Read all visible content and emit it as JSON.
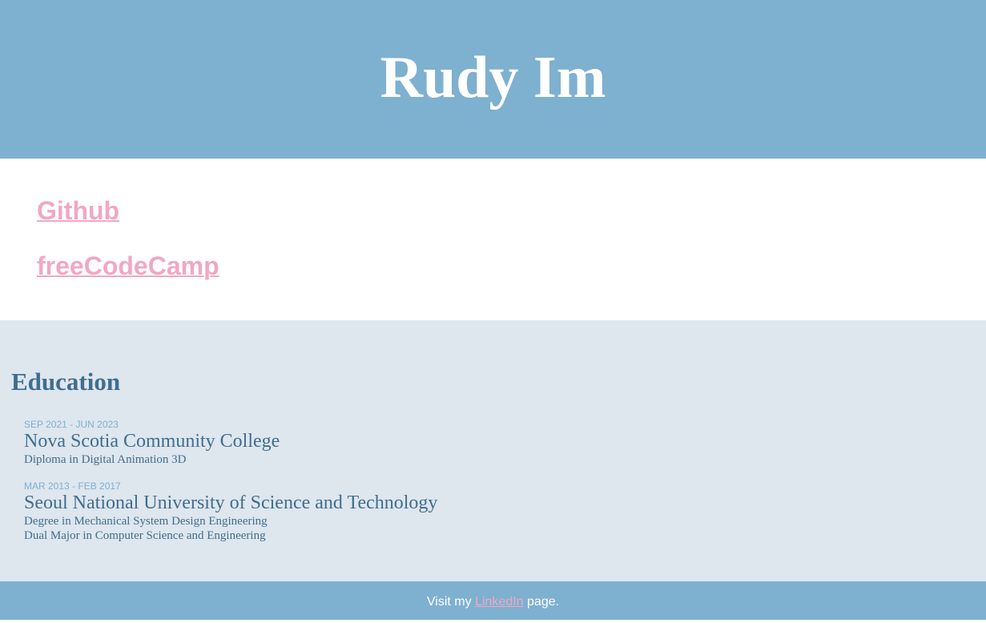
{
  "header": {
    "name": "Rudy Im"
  },
  "links": [
    {
      "label": "Github"
    },
    {
      "label": "freeCodeCamp"
    }
  ],
  "education": {
    "heading": "Education",
    "entries": [
      {
        "dates": "SEP 2021 - JUN 2023",
        "school": "Nova Scotia Community College",
        "details": [
          "Diploma in Digital Animation 3D"
        ]
      },
      {
        "dates": "MAR 2013 - FEB 2017",
        "school": "Seoul National University of Science and Technology",
        "details": [
          "Degree in Mechanical System Design Engineering",
          "Dual Major in Computer Science and Engineering"
        ]
      }
    ]
  },
  "footer": {
    "prefix": "Visit my",
    "link_label": "LinkedIn",
    "suffix": "page."
  },
  "colors": {
    "header_bg": "#7eb0d0",
    "section_bg": "#dee6ee",
    "link": "#f0a8c3",
    "heading_text": "#3f6e8f",
    "date_text": "#7eb0d0"
  }
}
